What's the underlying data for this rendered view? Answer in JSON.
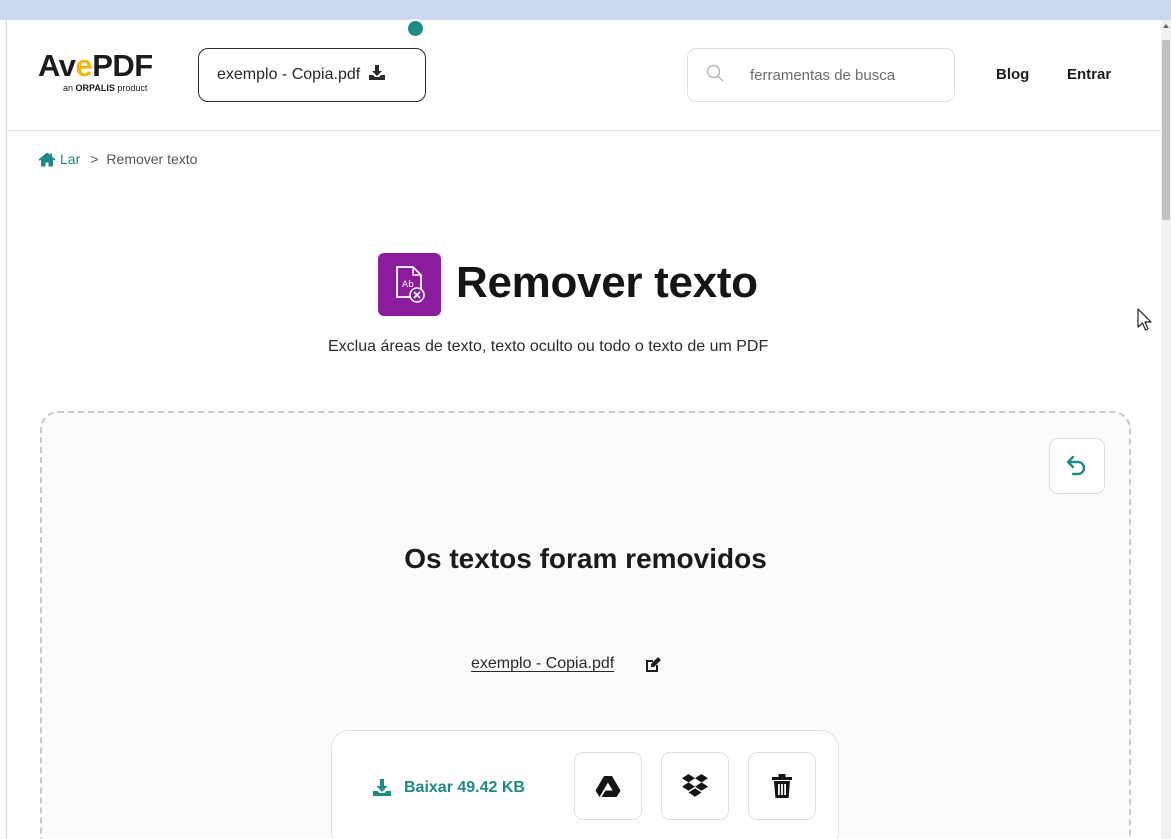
{
  "header": {
    "logo": {
      "word_left": "Av",
      "word_e": "e",
      "word_right": "PDF",
      "sub_prefix": "an ",
      "sub_brand": "ORPALIS",
      "sub_suffix": " product"
    },
    "file_pill_label": "exemplo - Copia.pdf",
    "search": {
      "placeholder": "ferramentas de busca",
      "value": ""
    },
    "nav": {
      "blog": "Blog",
      "login": "Entrar"
    }
  },
  "breadcrumb": {
    "home": "Lar",
    "separator": ">",
    "current": "Remover texto"
  },
  "tool": {
    "title": "Remover texto",
    "subtitle": "Exclua áreas de texto, texto oculto ou todo o texto de um PDF",
    "icon": "remove-text-icon"
  },
  "result": {
    "title": "Os textos foram removidos",
    "filename": "exemplo - Copia.pdf",
    "download_label": "Baixar 49.42 KB",
    "buttons": [
      "google-drive-icon",
      "dropbox-icon",
      "trash-icon"
    ]
  },
  "colors": {
    "accent": "#1f8a83",
    "tool_icon_bg": "#8b1c9e",
    "logo_e": "#f2b705",
    "top_strip": "#c9d9f0"
  }
}
